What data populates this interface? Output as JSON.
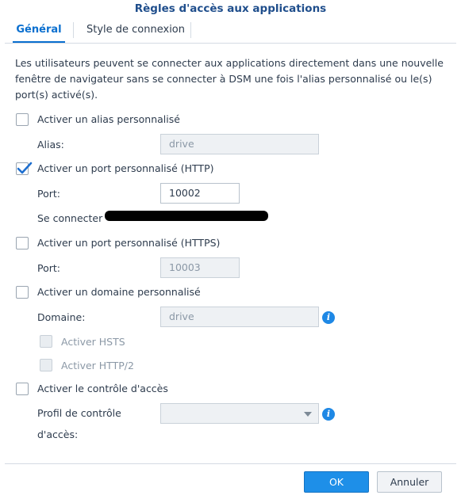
{
  "dialog": {
    "title": "Règles d'accès aux applications"
  },
  "tabs": [
    {
      "label": "Général",
      "active": true
    },
    {
      "label": "Style de connexion",
      "active": false
    }
  ],
  "description": "Les utilisateurs peuvent se connecter aux applications directement dans une nouvelle fenêtre de navigateur sans se connecter à DSM une fois l'alias personnalisé ou le(s) port(s) activé(s).",
  "options": {
    "custom_alias": {
      "label": "Activer un alias personnalisé",
      "checked": false,
      "field_label": "Alias:",
      "value": "drive"
    },
    "custom_http_port": {
      "label": "Activer un port personnalisé (HTTP)",
      "checked": true,
      "field_label": "Port:",
      "value": "10002",
      "connect_label": "Se connecter"
    },
    "custom_https_port": {
      "label": "Activer un port personnalisé (HTTPS)",
      "checked": false,
      "field_label": "Port:",
      "value": "10003"
    },
    "custom_domain": {
      "label": "Activer un domaine personnalisé",
      "checked": false,
      "field_label": "Domaine:",
      "value": "drive",
      "hsts_label": "Activer HSTS",
      "http2_label": "Activer HTTP/2"
    },
    "access_control": {
      "label": "Activer le contrôle d'accès",
      "checked": false,
      "field_label_line1": "Profil de contrôle",
      "field_label_line2": "d'accès:",
      "value": ""
    }
  },
  "footer": {
    "ok_label": "OK",
    "cancel_label": "Annuler"
  },
  "colors": {
    "accent": "#0a6fcf",
    "title": "#1f4e8c",
    "primary_button": "#1e8fe8",
    "info_icon": "#1e88e5"
  }
}
